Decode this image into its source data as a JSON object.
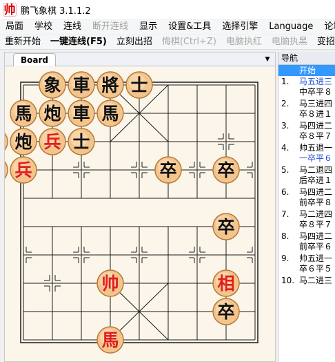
{
  "window": {
    "title": "鹏飞象棋 3.1.1.2",
    "icon_char": "帅"
  },
  "menu": [
    {
      "label": "局面",
      "enabled": true
    },
    {
      "label": "学校",
      "enabled": true
    },
    {
      "label": "连线",
      "enabled": true
    },
    {
      "label": "断开连线",
      "enabled": false
    },
    {
      "label": "显示",
      "enabled": true
    },
    {
      "label": "设置&工具",
      "enabled": true
    },
    {
      "label": "选择引擎",
      "enabled": true
    },
    {
      "label": "Language",
      "enabled": true
    },
    {
      "label": "论坛",
      "enabled": true
    }
  ],
  "toolbar": [
    {
      "label": "重新开始",
      "enabled": true,
      "bold": false
    },
    {
      "label": "一键连线(F5)",
      "enabled": true,
      "bold": true
    },
    {
      "label": "立刻出招",
      "enabled": true,
      "bold": false
    },
    {
      "label": "悔棋(Ctrl+Z)",
      "enabled": false,
      "bold": false
    },
    {
      "label": "电脑执红",
      "enabled": false,
      "bold": false
    },
    {
      "label": "电脑执黑",
      "enabled": false,
      "bold": false
    },
    {
      "label": "变招",
      "enabled": true,
      "bold": false
    }
  ],
  "board_tab": {
    "label": "Board",
    "menu_glyph": "▼"
  },
  "board": {
    "colors": {
      "board": "#fcf6ea",
      "line": "#1a1a1a",
      "piece_fill": "#f3c48c",
      "piece_edge": "#b57a3a",
      "red": "#e01e1e",
      "black": "#111111"
    },
    "pieces": [
      {
        "char": "象",
        "side": "black",
        "file": 1,
        "rank": 0
      },
      {
        "char": "車",
        "side": "black",
        "file": 2,
        "rank": 0
      },
      {
        "char": "將",
        "side": "black",
        "file": 3,
        "rank": 0
      },
      {
        "char": "士",
        "side": "black",
        "file": 4,
        "rank": 0
      },
      {
        "char": "馬",
        "side": "black",
        "file": 0,
        "rank": 1
      },
      {
        "char": "炮",
        "side": "black",
        "file": 1,
        "rank": 1
      },
      {
        "char": "車",
        "side": "black",
        "file": 2,
        "rank": 1
      },
      {
        "char": "馬",
        "side": "black",
        "file": 3,
        "rank": 1
      },
      {
        "char": "象",
        "side": "black",
        "file": -1,
        "rank": 2
      },
      {
        "char": "炮",
        "side": "black",
        "file": 0,
        "rank": 2
      },
      {
        "char": "兵",
        "side": "red",
        "file": 1,
        "rank": 2
      },
      {
        "char": "士",
        "side": "black",
        "file": 2,
        "rank": 2
      },
      {
        "char": "卒",
        "side": "black",
        "file": -1,
        "rank": 3
      },
      {
        "char": "兵",
        "side": "red",
        "file": 0,
        "rank": 3
      },
      {
        "char": "卒",
        "side": "black",
        "file": 5,
        "rank": 3
      },
      {
        "char": "卒",
        "side": "black",
        "file": 7,
        "rank": 3
      },
      {
        "char": "卒",
        "side": "black",
        "file": 7,
        "rank": 5
      },
      {
        "char": "帅",
        "side": "red",
        "file": 3,
        "rank": 7
      },
      {
        "char": "相",
        "side": "red",
        "file": 7,
        "rank": 7
      },
      {
        "char": "卒",
        "side": "black",
        "file": 7,
        "rank": 8
      },
      {
        "char": "馬",
        "side": "red",
        "file": 3,
        "rank": 9
      }
    ]
  },
  "nav": {
    "header": "导航",
    "start_label": "开始",
    "moves": [
      {
        "num": "1.",
        "red": "马五进三",
        "black": "中卒平８",
        "red_selected": true,
        "black_selected": false
      },
      {
        "num": "2.",
        "red": "马三进四",
        "black": "卒８进１",
        "red_selected": false,
        "black_selected": false
      },
      {
        "num": "3.",
        "red": "马四进二",
        "black": "卒８平７",
        "red_selected": false,
        "black_selected": false
      },
      {
        "num": "4.",
        "red": "帅五退一",
        "black": "一卒平６",
        "red_selected": false,
        "black_selected": true
      },
      {
        "num": "5.",
        "red": "马二退四",
        "black": "后卒进１",
        "red_selected": false,
        "black_selected": false
      },
      {
        "num": "6.",
        "red": "马四进二",
        "black": "前卒平８",
        "red_selected": false,
        "black_selected": false
      },
      {
        "num": "7.",
        "red": "马二进四",
        "black": "卒８平７",
        "red_selected": false,
        "black_selected": false
      },
      {
        "num": "8.",
        "red": "马四进二",
        "black": "前卒平６",
        "red_selected": false,
        "black_selected": false
      },
      {
        "num": "9.",
        "red": "帅五进一",
        "black": "卒６平５",
        "red_selected": false,
        "black_selected": false
      },
      {
        "num": "10.",
        "red": "马二进三",
        "black": "",
        "red_selected": false,
        "black_selected": false
      }
    ]
  }
}
